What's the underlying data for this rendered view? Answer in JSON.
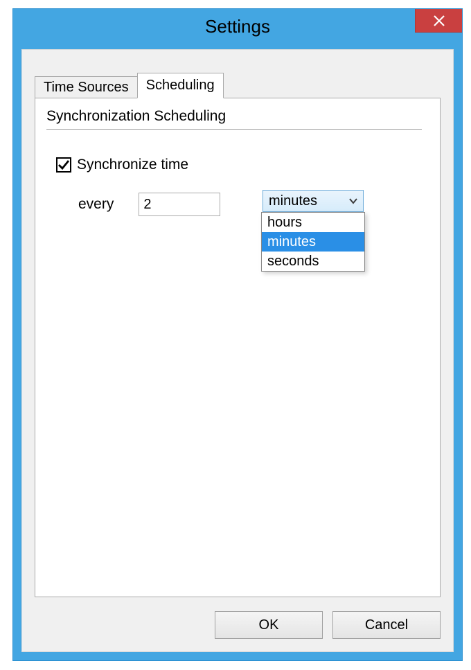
{
  "window": {
    "title": "Settings"
  },
  "tabs": [
    {
      "label": "Time Sources",
      "active": false
    },
    {
      "label": "Scheduling",
      "active": true
    }
  ],
  "section": {
    "title": "Synchronization Scheduling"
  },
  "sync": {
    "checkbox_label": "Synchronize time",
    "checked": true,
    "every_label": "every",
    "interval_value": "2",
    "unit_selected": "minutes",
    "unit_options": [
      "hours",
      "minutes",
      "seconds"
    ]
  },
  "buttons": {
    "ok": "OK",
    "cancel": "Cancel"
  }
}
